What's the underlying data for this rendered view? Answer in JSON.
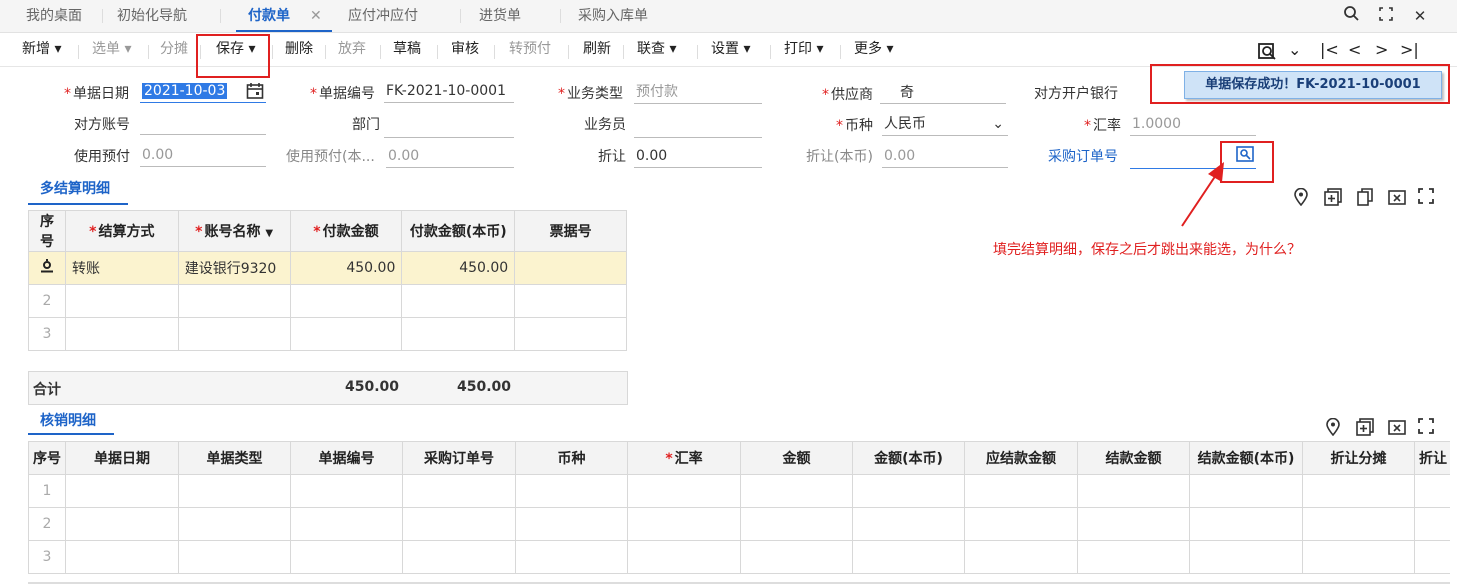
{
  "tabs": [
    "我的桌面",
    "初始化导航",
    "付款单",
    "应付冲应付",
    "进货单",
    "采购入库单"
  ],
  "tab_close": "✕",
  "window_buttons": {
    "search": "search-icon",
    "restore": "restore-icon",
    "close": "✕"
  },
  "toolbar": {
    "new": "新增",
    "select": "选单",
    "split": "分摊",
    "save": "保存",
    "delete": "删除",
    "discard": "放弃",
    "draft": "草稿",
    "audit": "审核",
    "to_prepay": "转预付",
    "refresh": "刷新",
    "lookup": "联查",
    "settings": "设置",
    "print": "打印",
    "more": "更多"
  },
  "toast": "单据保存成功！FK-2021-10-0001",
  "form": {
    "date_label": "单据日期",
    "date_value": "2021-10-03",
    "no_label": "单据编号",
    "no_value": "FK-2021-10-0001",
    "biztype_label": "业务类型",
    "biztype_value": "预付款",
    "supplier_label": "供应商",
    "supplier_value": "奇",
    "bank_label": "对方开户银行",
    "bank_value": "",
    "account_label": "对方账号",
    "account_value": "",
    "dept_label": "部门",
    "dept_value": "",
    "clerk_label": "业务员",
    "clerk_value": "",
    "currency_label": "币种",
    "currency_value": "人民币",
    "rate_label": "汇率",
    "rate_value": "1.0000",
    "prepay_label": "使用预付",
    "prepay_value": "0.00",
    "prepay_local_label": "使用预付(本...",
    "prepay_local_value": "0.00",
    "discount_label": "折让",
    "discount_value": "0.00",
    "discount_local_label": "折让(本币)",
    "discount_local_value": "0.00",
    "po_label": "采购订单号",
    "po_value": ""
  },
  "settle": {
    "title": "多结算明细",
    "headers": [
      "序号",
      "结算方式",
      "账号名称",
      "付款金额",
      "付款金额(本币)",
      "票据号"
    ],
    "rows": [
      {
        "no": "",
        "method": "转账",
        "account": "建设银行9320",
        "amount": "450.00",
        "amount_local": "450.00",
        "bill": ""
      },
      {
        "no": "2",
        "method": "",
        "account": "",
        "amount": "",
        "amount_local": "",
        "bill": ""
      },
      {
        "no": "3",
        "method": "",
        "account": "",
        "amount": "",
        "amount_local": "",
        "bill": ""
      }
    ],
    "total_label": "合计",
    "total_amount": "450.00",
    "total_local": "450.00"
  },
  "writeoff": {
    "title": "核销明细",
    "headers": [
      "序号",
      "单据日期",
      "单据类型",
      "单据编号",
      "采购订单号",
      "币种",
      "汇率",
      "金额",
      "金额(本币)",
      "应结款金额",
      "结款金额",
      "结款金额(本币)",
      "折让分摊",
      "折让"
    ],
    "rows": [
      "1",
      "2",
      "3"
    ]
  },
  "annotation": "填完结算明细，保存之后才跳出来能选，为什么？",
  "colors": {
    "accent": "#1e64c8",
    "annotation": "#e02020",
    "highlight_row": "#fbf3cf",
    "toast_bg": "#cfe3f7"
  }
}
